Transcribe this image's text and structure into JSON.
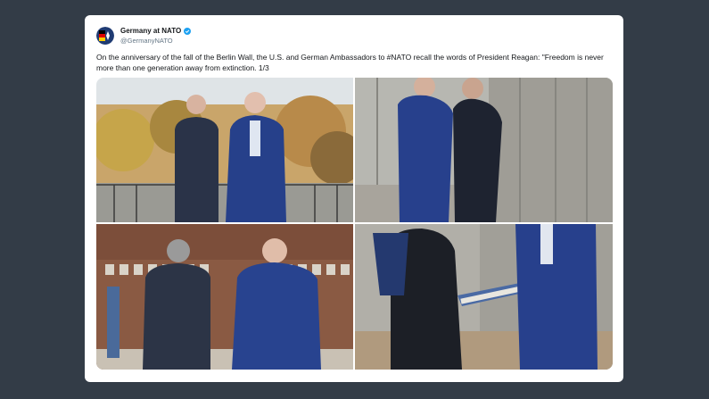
{
  "tweet": {
    "display_name": "Germany at NATO",
    "handle": "@GermanyNATO",
    "verified": true,
    "text": "On the anniversary of the fall of the Berlin Wall, the U.S. and German Ambassadors to #NATO recall the words of President Reagan: \"Freedom is never more than one generation away from extinction. 1/3"
  },
  "colors": {
    "background": "#333c47",
    "card": "#ffffff",
    "verified_badge": "#1da1f2",
    "text": "#14171a",
    "secondary_text": "#657786"
  },
  "media": {
    "photo_count": 4
  }
}
